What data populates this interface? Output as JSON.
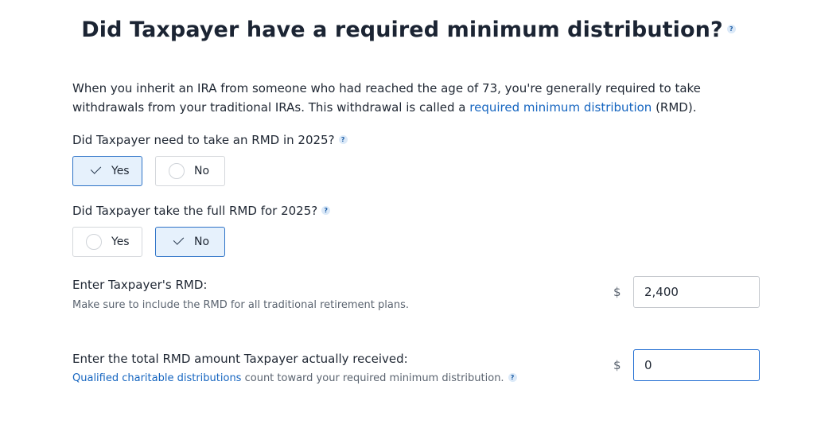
{
  "page": {
    "title": "Did Taxpayer have a required minimum distribution?",
    "help_glyph": "?"
  },
  "intro": {
    "text_before": "When you inherit an IRA from someone who had reached the age of 73, you're generally required to take withdrawals from your traditional IRAs. This withdrawal is called a ",
    "link_text": "required minimum distribution",
    "text_after": " (RMD)."
  },
  "q1": {
    "question": "Did Taxpayer need to take an RMD in 2025?",
    "options": [
      {
        "label": "Yes",
        "selected": true
      },
      {
        "label": "No",
        "selected": false
      }
    ]
  },
  "q2": {
    "question": "Did Taxpayer take the full RMD for 2025?",
    "options": [
      {
        "label": "Yes",
        "selected": false
      },
      {
        "label": "No",
        "selected": true
      }
    ]
  },
  "rmd_field": {
    "label": "Enter Taxpayer's RMD:",
    "hint": "Make sure to include the RMD for all traditional retirement plans.",
    "currency": "$",
    "value": "2,400"
  },
  "received_field": {
    "label": "Enter the total RMD amount Taxpayer actually received:",
    "hint_link": "Qualified charitable distributions",
    "hint_text": " count toward your required minimum distribution.",
    "currency": "$",
    "value": "0"
  },
  "colors": {
    "selected_bg": "#e6f1fc",
    "selected_border": "#2e73c7",
    "link": "#1565c0",
    "focus_border": "#1e6bd1"
  }
}
